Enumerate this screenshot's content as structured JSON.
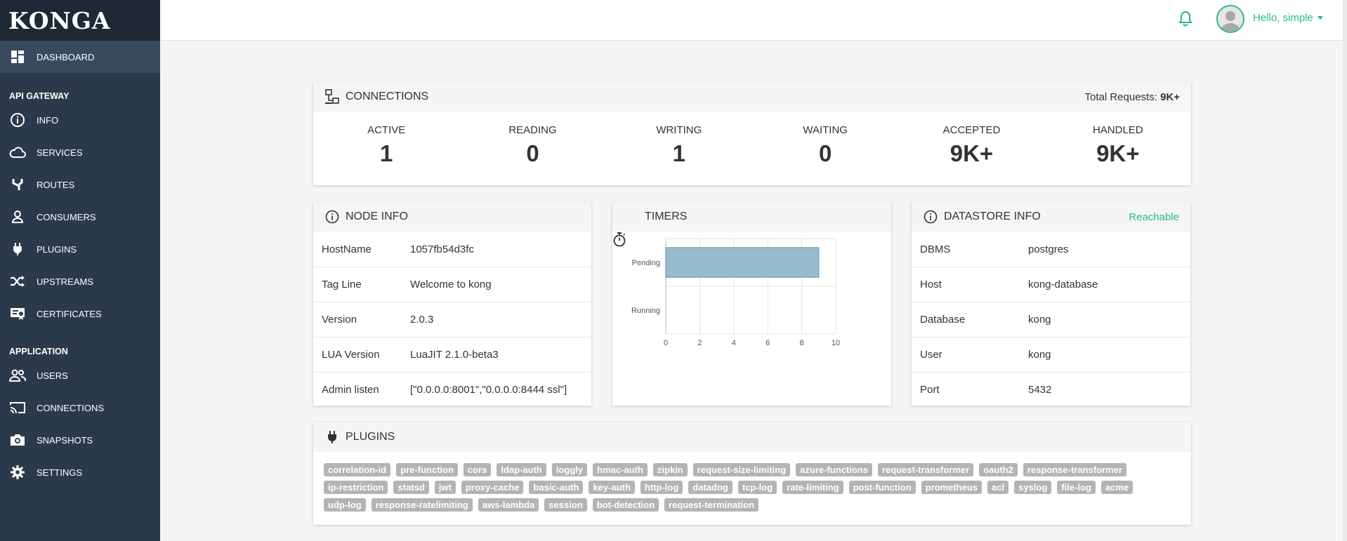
{
  "app": {
    "logo": "KONGA"
  },
  "sidebar": {
    "dashboard": {
      "label": "DASHBOARD",
      "icon": "dashboard-icon"
    },
    "section_gateway": "API GATEWAY",
    "gateway_items": [
      {
        "label": "INFO",
        "icon": "info-icon"
      },
      {
        "label": "SERVICES",
        "icon": "cloud-icon"
      },
      {
        "label": "ROUTES",
        "icon": "routes-icon"
      },
      {
        "label": "CONSUMERS",
        "icon": "user-icon"
      },
      {
        "label": "PLUGINS",
        "icon": "plug-icon"
      },
      {
        "label": "UPSTREAMS",
        "icon": "shuffle-icon"
      },
      {
        "label": "CERTIFICATES",
        "icon": "certificate-icon"
      }
    ],
    "section_application": "APPLICATION",
    "application_items": [
      {
        "label": "USERS",
        "icon": "users-icon"
      },
      {
        "label": "CONNECTIONS",
        "icon": "cast-icon"
      },
      {
        "label": "SNAPSHOTS",
        "icon": "camera-icon"
      },
      {
        "label": "SETTINGS",
        "icon": "gear-icon"
      }
    ]
  },
  "topbar": {
    "greeting": "Hello, simple",
    "accent": "#2bb596"
  },
  "connections": {
    "title": "CONNECTIONS",
    "total_label": "Total Requests:",
    "total_value": "9K+",
    "stats": [
      {
        "label": "ACTIVE",
        "value": "1"
      },
      {
        "label": "READING",
        "value": "0"
      },
      {
        "label": "WRITING",
        "value": "1"
      },
      {
        "label": "WAITING",
        "value": "0"
      },
      {
        "label": "ACCEPTED",
        "value": "9K+"
      },
      {
        "label": "HANDLED",
        "value": "9K+"
      }
    ]
  },
  "node_info": {
    "title": "NODE INFO",
    "rows": [
      {
        "key": "HostName",
        "value": "1057fb54d3fc"
      },
      {
        "key": "Tag Line",
        "value": "Welcome to kong"
      },
      {
        "key": "Version",
        "value": "2.0.3"
      },
      {
        "key": "LUA Version",
        "value": "LuaJIT 2.1.0-beta3"
      },
      {
        "key": "Admin listen",
        "value": "[\"0.0.0.0:8001\",\"0.0.0.0:8444 ssl\"]"
      }
    ]
  },
  "timers": {
    "title": "TIMERS"
  },
  "datastore": {
    "title": "DATASTORE INFO",
    "status": "Reachable",
    "rows": [
      {
        "key": "DBMS",
        "value": "postgres"
      },
      {
        "key": "Host",
        "value": "kong-database"
      },
      {
        "key": "Database",
        "value": "kong"
      },
      {
        "key": "User",
        "value": "kong"
      },
      {
        "key": "Port",
        "value": "5432"
      }
    ]
  },
  "plugins": {
    "title": "PLUGINS",
    "tags": [
      "correlation-id",
      "pre-function",
      "cors",
      "ldap-auth",
      "loggly",
      "hmac-auth",
      "zipkin",
      "request-size-limiting",
      "azure-functions",
      "request-transformer",
      "oauth2",
      "response-transformer",
      "ip-restriction",
      "statsd",
      "jwt",
      "proxy-cache",
      "basic-auth",
      "key-auth",
      "http-log",
      "datadog",
      "tcp-log",
      "rate-limiting",
      "post-function",
      "prometheus",
      "acl",
      "syslog",
      "file-log",
      "acme",
      "udp-log",
      "response-ratelimiting",
      "aws-lambda",
      "session",
      "bot-detection",
      "request-termination"
    ]
  },
  "chart_data": {
    "type": "bar",
    "orientation": "horizontal",
    "categories": [
      "Pending",
      "Running"
    ],
    "values": [
      9,
      0
    ],
    "xlim": [
      0,
      10
    ],
    "xticks": [
      0,
      2,
      4,
      6,
      8,
      10
    ],
    "grid": true,
    "bar_color": "#97bbcd",
    "bar_border": "#7fa6b8"
  }
}
